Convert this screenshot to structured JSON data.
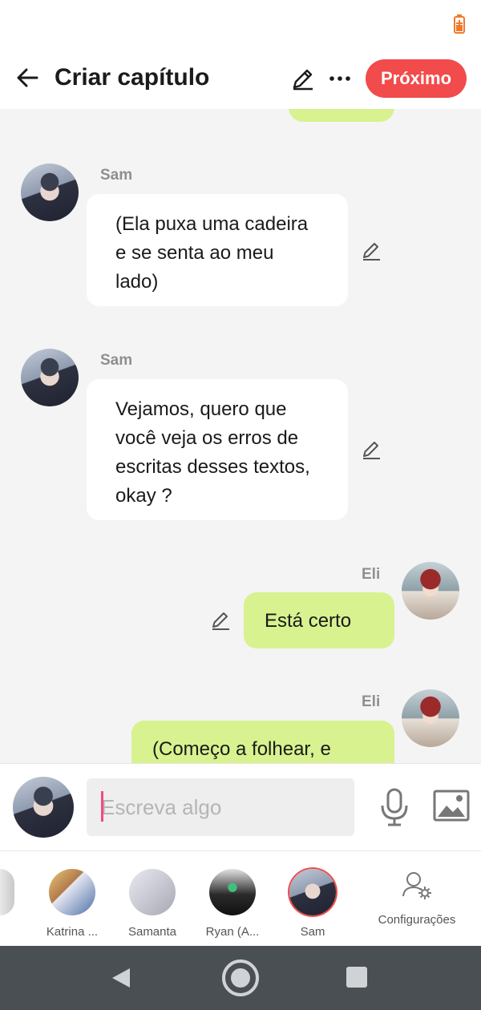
{
  "header": {
    "title": "Criar capítulo",
    "next_label": "Próximo"
  },
  "messages": [
    {
      "side": "left",
      "name": "Sam",
      "text": "(Ela puxa uma cadeira e se senta ao meu lado)"
    },
    {
      "side": "left",
      "name": "Sam",
      "text": "Vejamos, quero que você veja os erros de escritas desses textos, okay ?"
    },
    {
      "side": "right",
      "name": "Eli",
      "text": "Está certo"
    },
    {
      "side": "right",
      "name": "Eli",
      "text": "(Começo a folhear, e"
    }
  ],
  "composer": {
    "placeholder": "Escreva algo",
    "value": ""
  },
  "characters": [
    {
      "label": "Katrina ..."
    },
    {
      "label": "Samanta"
    },
    {
      "label": "Ryan (A..."
    },
    {
      "label": "Sam",
      "selected": true
    }
  ],
  "settings_label": "Configurações",
  "colors": {
    "accent": "#f24b4b",
    "bubble_right": "#d7f28f",
    "bubble_left": "#ffffff"
  }
}
